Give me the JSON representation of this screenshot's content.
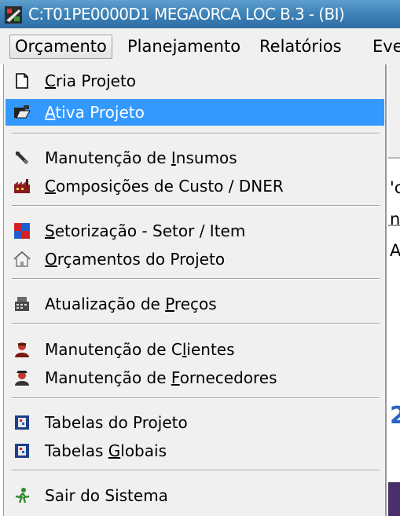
{
  "window": {
    "title": "C:T01PE0000D1 MEGAORCA LOC B.3 - (BI)"
  },
  "menubar": {
    "items": [
      {
        "label": "Orçamento",
        "active": true
      },
      {
        "label": "Planejamento"
      },
      {
        "label": "Relatórios"
      },
      {
        "label": "Eve"
      }
    ]
  },
  "menu": {
    "items": [
      {
        "label": "Cria Projeto",
        "mnemonic": "C",
        "icon": "blank-page-icon"
      },
      {
        "label": "Ativa Projeto",
        "mnemonic": "A",
        "icon": "open-folder-icon",
        "highlighted": true
      },
      {
        "label": "Manutenção  de Insumos",
        "mnemonic": "I",
        "icon": "wrench-icon"
      },
      {
        "label": "Composições de Custo / DNER",
        "mnemonic": "C",
        "icon": "factory-icon"
      },
      {
        "label": "Setorização - Setor / Item",
        "mnemonic": "S",
        "icon": "sectors-icon"
      },
      {
        "label": "Orçamentos do Projeto",
        "mnemonic": "O",
        "icon": "house-icon"
      },
      {
        "label": "Atualização de Preços",
        "mnemonic": "P",
        "icon": "cash-register-icon"
      },
      {
        "label": "Manutenção  de Clientes",
        "mnemonic": "l",
        "icon": "client-person-icon"
      },
      {
        "label": "Manutenção  de Fornecedores",
        "mnemonic": "F",
        "icon": "supplier-person-icon"
      },
      {
        "label": "Tabelas do Projeto",
        "mnemonic": "",
        "icon": "table-icon"
      },
      {
        "label": "Tabelas Globais",
        "mnemonic": "G",
        "icon": "table-icon"
      },
      {
        "label": "Sair do Sistema",
        "mnemonic": "",
        "icon": "running-man-icon"
      }
    ]
  },
  "background_fragments": [
    "'c",
    "n",
    "A",
    "2"
  ],
  "colors": {
    "titlebar": "#3f83b8",
    "highlight": "#3399ff",
    "menu_bg": "#f0f0f0"
  }
}
